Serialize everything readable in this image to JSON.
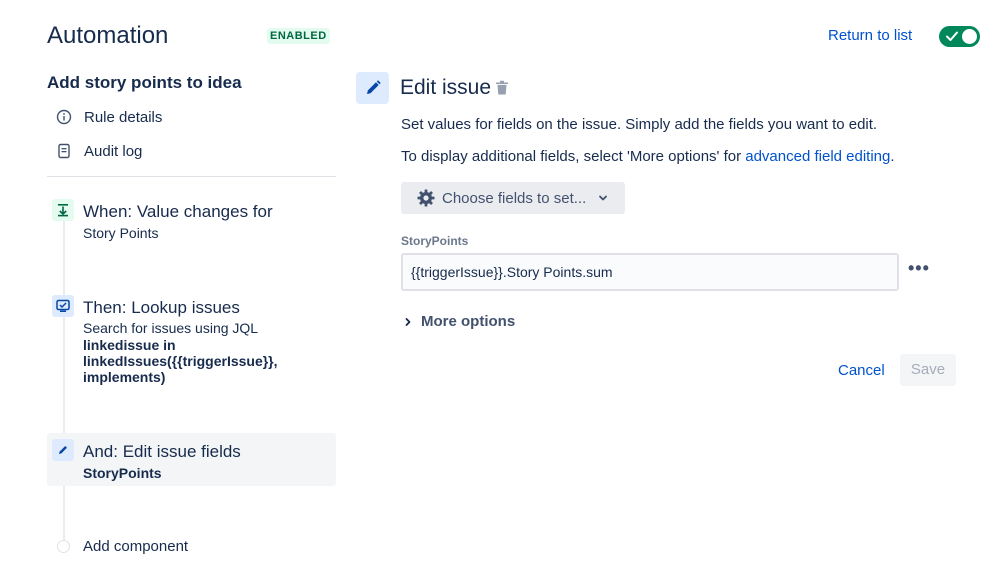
{
  "header": {
    "title": "Automation",
    "status_badge": "ENABLED",
    "return_link": "Return to list",
    "toggle_on": true
  },
  "rule": {
    "name": "Add story points to idea",
    "nav": [
      {
        "label": "Rule details",
        "icon": "info-icon"
      },
      {
        "label": "Audit log",
        "icon": "document-icon"
      }
    ],
    "steps": [
      {
        "title": "When: Value changes for",
        "sub": "Story Points",
        "icon": "trigger-icon",
        "icon_color": "#e3fcef"
      },
      {
        "title": "Then: Lookup issues",
        "sub": "Search for issues using JQL",
        "bold_lines": [
          "linkedissue in",
          "linkedIssues({{triggerIssue}},",
          "implements)"
        ],
        "icon": "lookup-icon",
        "icon_color": "#deebff"
      },
      {
        "title": "And: Edit issue fields",
        "bold_sub": "StoryPoints",
        "icon": "pencil-icon",
        "icon_color": "#deebff",
        "selected": true
      }
    ],
    "add_component": "Add component"
  },
  "panel": {
    "title": "Edit issue",
    "desc1": "Set values for fields on the issue. Simply add the fields you want to edit.",
    "desc2_prefix": "To display additional fields, select 'More options' for ",
    "desc2_link": "advanced field editing",
    "desc2_suffix": ".",
    "choose_fields": "Choose fields to set...",
    "field_label": "StoryPoints",
    "field_value": "{{triggerIssue}}.Story Points.sum",
    "more_dots": "•••",
    "more_options": "More options",
    "cancel": "Cancel",
    "save": "Save"
  },
  "colors": {
    "accent": "#0052cc",
    "toggle": "#00875a",
    "badge_bg": "#e3fcef",
    "badge_text": "#006644"
  }
}
